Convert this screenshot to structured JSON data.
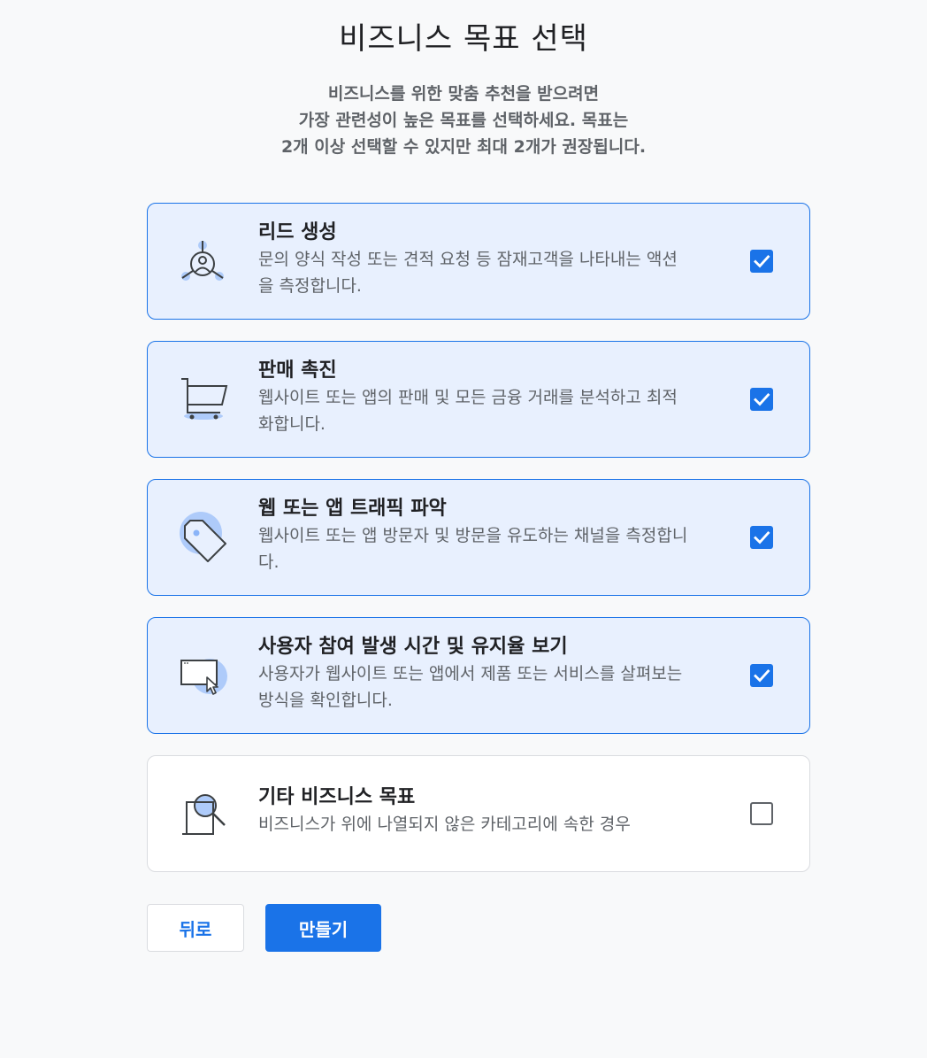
{
  "page": {
    "title": "비즈니스 목표 선택",
    "subtitle_lines": [
      "비즈니스를 위한 맞춤 추천을 받으려면",
      "가장 관련성이 높은 목표를 선택하세요. 목표는",
      "2개 이상 선택할 수 있지만 최대 2개가 권장됩니다."
    ]
  },
  "goals": [
    {
      "title": "리드 생성",
      "description_lines": [
        "문의 양식 작성 또는 견적 요청 등 잠재고객을 나타내는 액션",
        "을 측정합니다."
      ],
      "icon": "lead-generation-icon",
      "checked": true
    },
    {
      "title": "판매 촉진",
      "description_lines": [
        "웹사이트 또는 앱의 판매 및 모든 금융 거래를 분석하고 최적",
        "화합니다."
      ],
      "icon": "shopping-cart-icon",
      "checked": true
    },
    {
      "title": "웹 또는 앱 트래픽 파악",
      "description_lines": [
        "웹사이트 또는 앱 방문자 및 방문을 유도하는 채널을 측정합니",
        "다."
      ],
      "icon": "price-tag-icon",
      "checked": true
    },
    {
      "title": "사용자 참여 발생 시간 및 유지율 보기",
      "description_lines": [
        "사용자가 웹사이트 또는 앱에서 제품 또는 서비스를 살펴보는",
        "방식을 확인합니다."
      ],
      "icon": "browser-window-cursor-icon",
      "checked": true
    },
    {
      "title": "기타 비즈니스 목표",
      "description_lines": [
        "비즈니스가 위에 나열되지 않은 카테고리에 속한 경우"
      ],
      "icon": "magnifier-document-icon",
      "checked": false
    }
  ],
  "buttons": {
    "back_label": "뒤로",
    "create_label": "만들기"
  },
  "colors": {
    "accent": "#1a73e8",
    "selected_card_bg": "#e8f0fe",
    "icon_highlight": "#aecbfa",
    "page_bg": "#f8f9fa"
  }
}
